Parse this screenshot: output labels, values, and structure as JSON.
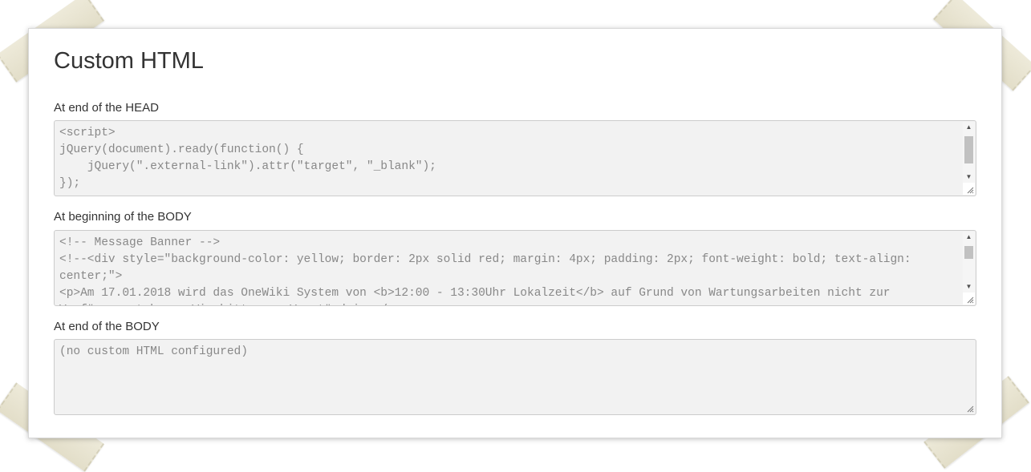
{
  "page": {
    "title": "Custom HTML"
  },
  "fields": [
    {
      "label": "At end of the HEAD",
      "value": "<script>\njQuery(document).ready(function() {\n    jQuery(\".external-link\").attr(\"target\", \"_blank\");\n});"
    },
    {
      "label": "At beginning of the BODY",
      "value": "<!-- Message Banner -->\n<!--<div style=\"background-color: yellow; border: 2px solid red; margin: 4px; padding: 2px; font-weight: bold; text-align: center;\">\n<p>Am 17.01.2018 wird das OneWiki System von <b>12:00 - 13:30Uhr Lokalzeit</b> auf Grund von Wartungsarbeiten nicht zur Verfügung stehen.  Wir bitten um Verständnis.</p>"
    },
    {
      "label": "At end of the BODY",
      "value": "(no custom HTML configured)"
    }
  ],
  "icons": {
    "scroll_up": "scroll-up-arrow-icon",
    "scroll_down": "scroll-down-arrow-icon",
    "resize": "resize-grip-icon"
  },
  "colors": {
    "textarea_bg": "#f2f2f2",
    "textarea_border": "#cccccc",
    "text_muted": "#888888",
    "heading": "#333333"
  }
}
